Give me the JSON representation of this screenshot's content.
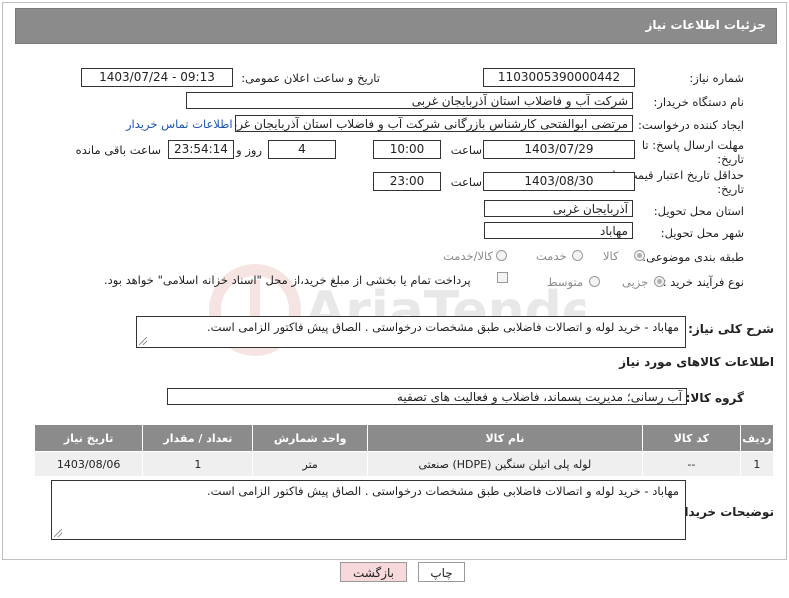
{
  "header": {
    "title": "جزئیات اطلاعات نیاز"
  },
  "fields": {
    "need_number_label": "شماره نیاز:",
    "need_number": "1103005390000442",
    "announce_label": "تاریخ و ساعت اعلان عمومی:",
    "announce_value": "1403/07/24 - 09:13",
    "buyer_label": "نام دستگاه خریدار:",
    "buyer_value": "شرکت آب و فاضلاب استان آذربایجان غربی",
    "creator_label": "ایجاد کننده درخواست:",
    "creator_value": "مرتضی ابوالفتحی کارشناس بازرگانی شرکت آب و فاضلاب استان آذربایجان غربی",
    "contact_link": "اطلاعات تماس خریدار",
    "deadline_label_1": "مهلت ارسال پاسخ: تا",
    "deadline_label_2": "تاریخ:",
    "deadline_date": "1403/07/29",
    "time_label": "ساعت",
    "deadline_time": "10:00",
    "days_value": "4",
    "days_label": "روز و",
    "remaining_time": "23:54:14",
    "remaining_label": "ساعت باقی مانده",
    "validity_label_1": "حداقل تاریخ اعتبار قیمت: تا",
    "validity_label_2": "تاریخ:",
    "validity_date": "1403/08/30",
    "validity_time": "23:00",
    "province_label": "استان محل تحویل:",
    "province_value": "آذربایجان غربی",
    "city_label": "شهر محل تحویل:",
    "city_value": "مهاباد",
    "category_label": "طبقه بندی موضوعی:",
    "category_options": [
      "کالا",
      "خدمت",
      "کالا/خدمت"
    ],
    "process_label": "نوع فرآیند خرید :",
    "process_options": [
      "جزیی",
      "متوسط"
    ],
    "payment_note": "پرداخت تمام یا بخشی از مبلغ خرید،از محل \"اسناد خزانه اسلامی\" خواهد بود.",
    "description_label": "شرح کلی نیاز:",
    "description_value": "مهاباد -  خرید لوله و اتصالات فاضلابی طبق مشخصات درخواستی . الصاق پیش فاکتور الزامی است.",
    "goods_info_label": "اطلاعات کالاهای مورد نیاز",
    "goods_group_label": "گروه کالا:",
    "goods_group_value": "آب رسانی؛ مدیریت پسماند، فاضلاب و فعالیت های تصفیه",
    "buyer_notes_label": "توضیحات خریدار:",
    "buyer_notes_value": "مهاباد -  خرید لوله و اتصالات فاضلابی طبق مشخصات درخواستی . الصاق پیش فاکتور الزامی است."
  },
  "table": {
    "headers": [
      "ردیف",
      "کد کالا",
      "نام کالا",
      "واحد شمارش",
      "تعداد / مقدار",
      "تاریخ نیاز"
    ],
    "rows": [
      {
        "row": "1",
        "code": "--",
        "name": "لوله پلی اتیلن سنگین (HDPE) صنعتی",
        "unit": "متر",
        "qty": "1",
        "date": "1403/08/06"
      }
    ]
  },
  "buttons": {
    "print": "چاپ",
    "back": "بازگشت"
  },
  "watermark_text": "AriaTender.net",
  "colors": {
    "header_bg": "#8b8b8b",
    "link": "#1a55b0",
    "back_button_bg": "#f7d9dc"
  }
}
